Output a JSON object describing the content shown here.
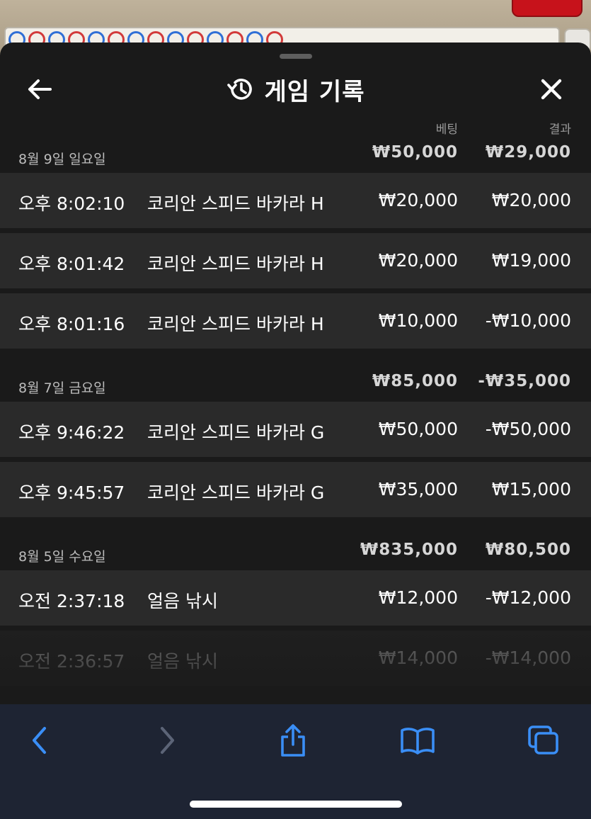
{
  "header": {
    "title": "게임 기록"
  },
  "columns": {
    "bet": "베팅",
    "result": "결과"
  },
  "days": [
    {
      "label": "8월 9일 일요일",
      "total_bet": "₩50,000",
      "total_result": "₩29,000",
      "rows": [
        {
          "time": "오후 8:02:10",
          "game": "코리안 스피드 바카라 H",
          "bet": "₩20,000",
          "result": "₩20,000"
        },
        {
          "time": "오후 8:01:42",
          "game": "코리안 스피드 바카라 H",
          "bet": "₩20,000",
          "result": "₩19,000"
        },
        {
          "time": "오후 8:01:16",
          "game": "코리안 스피드 바카라 H",
          "bet": "₩10,000",
          "result": "-₩10,000"
        }
      ]
    },
    {
      "label": "8월 7일 금요일",
      "total_bet": "₩85,000",
      "total_result": "-₩35,000",
      "rows": [
        {
          "time": "오후 9:46:22",
          "game": "코리안 스피드 바카라 G",
          "bet": "₩50,000",
          "result": "-₩50,000"
        },
        {
          "time": "오후 9:45:57",
          "game": "코리안 스피드 바카라 G",
          "bet": "₩35,000",
          "result": "₩15,000"
        }
      ]
    },
    {
      "label": "8월 5일 수요일",
      "total_bet": "₩835,000",
      "total_result": "₩80,500",
      "rows": [
        {
          "time": "오전 2:37:18",
          "game": "얼음 낚시",
          "bet": "₩12,000",
          "result": "-₩12,000"
        },
        {
          "time": "오전 2:36:57",
          "game": "얼음 낚시",
          "bet": "₩14,000",
          "result": "-₩14,000"
        }
      ]
    }
  ],
  "colors": {
    "sheet_bg": "#1a1a1a",
    "row_bg": "#2a2a2a",
    "toolbar_bg": "#1e2433",
    "toolbar_accent": "#3a8ef6",
    "roadmap_red": "#d23a3a",
    "roadmap_blue": "#2f6fd6"
  },
  "icons": {
    "back": "arrow-left-icon",
    "history": "history-icon",
    "close": "close-icon",
    "browser_back": "chevron-left-icon",
    "browser_forward": "chevron-right-icon",
    "share": "share-icon",
    "bookmarks": "book-icon",
    "tabs": "tabs-icon"
  }
}
